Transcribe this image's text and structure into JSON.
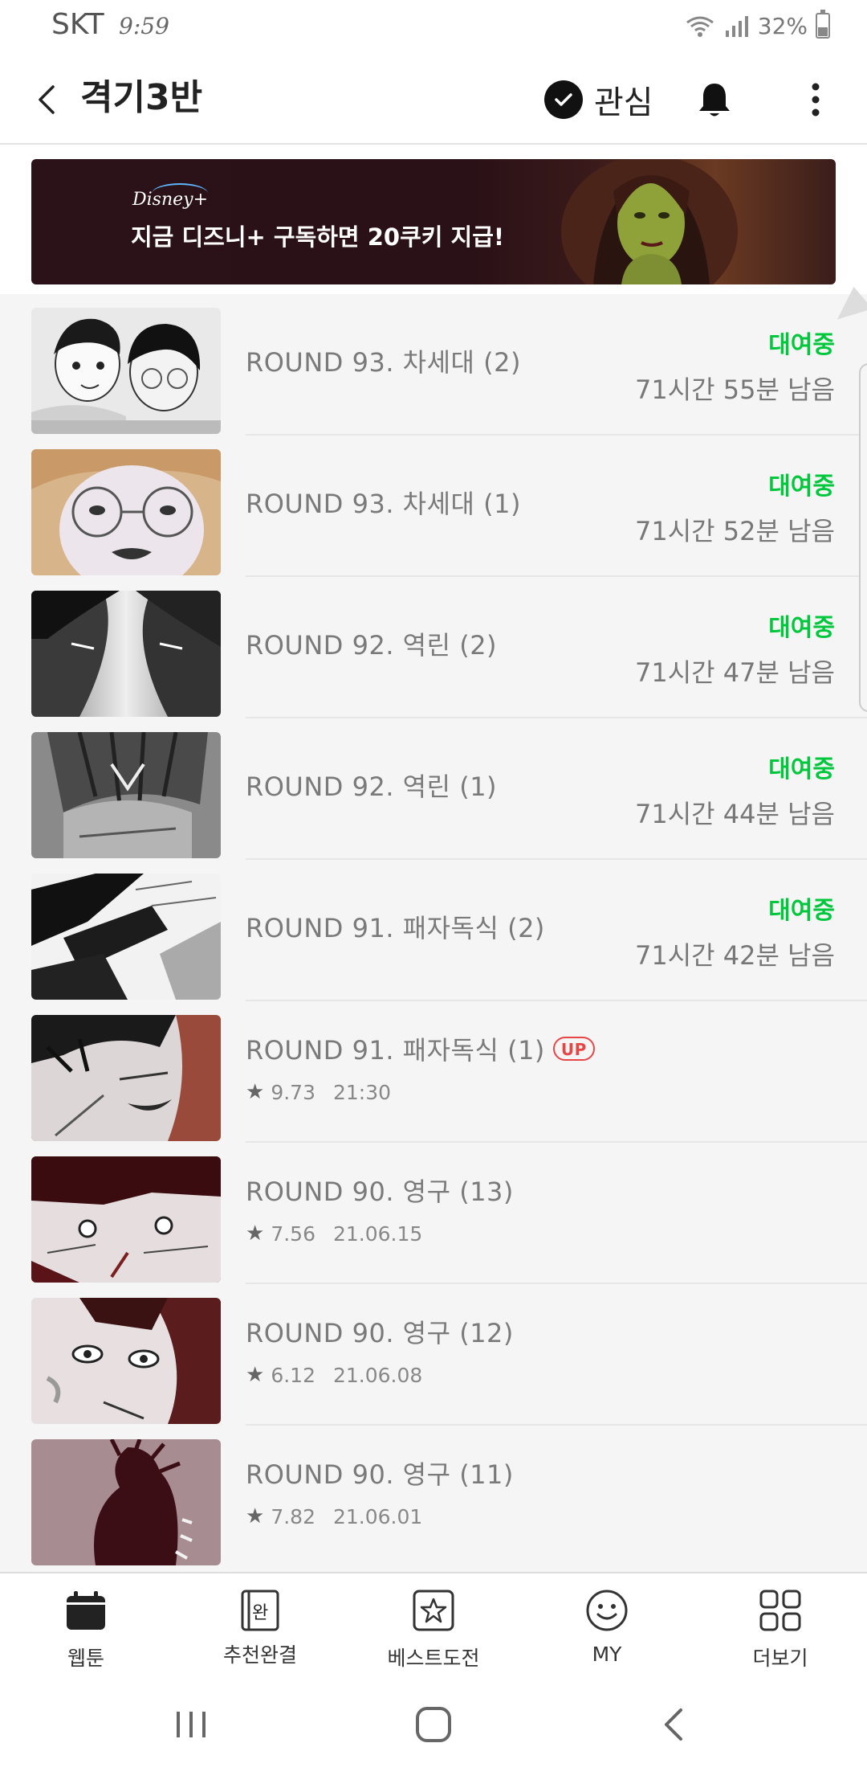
{
  "status_bar": {
    "carrier": "SKT",
    "time": "9:59",
    "battery": "32%"
  },
  "header": {
    "title": "격기3반",
    "favorite_label": "관심"
  },
  "banner": {
    "logo": "Disney+",
    "text": "지금 디즈니+ 구독하면 20쿠키 지급!"
  },
  "episodes": [
    {
      "title": "ROUND 93. 차세대 (2)",
      "status": "대여중",
      "time_left": "71시간 55분 남음"
    },
    {
      "title": "ROUND 93. 차세대 (1)",
      "status": "대여중",
      "time_left": "71시간 52분 남음"
    },
    {
      "title": "ROUND 92. 역린 (2)",
      "status": "대여중",
      "time_left": "71시간 47분 남음"
    },
    {
      "title": "ROUND 92. 역린 (1)",
      "status": "대여중",
      "time_left": "71시간 44분 남음"
    },
    {
      "title": "ROUND 91. 패자독식 (2)",
      "status": "대여중",
      "time_left": "71시간 42분 남음"
    },
    {
      "title": "ROUND 91. 패자독식 (1)",
      "badge": "UP",
      "rating": "9.73",
      "date": "21:30"
    },
    {
      "title": "ROUND 90. 영구 (13)",
      "rating": "7.56",
      "date": "21.06.15"
    },
    {
      "title": "ROUND 90. 영구 (12)",
      "rating": "6.12",
      "date": "21.06.08"
    },
    {
      "title": "ROUND 90. 영구 (11)",
      "rating": "7.82",
      "date": "21.06.01"
    }
  ],
  "bottom_nav": [
    {
      "label": "웹툰",
      "icon": "calendar-icon"
    },
    {
      "label": "추천완결",
      "icon": "complete-book-icon",
      "icon_text": "완"
    },
    {
      "label": "베스트도전",
      "icon": "star-box-icon"
    },
    {
      "label": "MY",
      "icon": "smiley-icon"
    },
    {
      "label": "더보기",
      "icon": "grid-icon"
    }
  ],
  "colors": {
    "rent_green": "#00c73c",
    "up_red": "#e84545"
  }
}
